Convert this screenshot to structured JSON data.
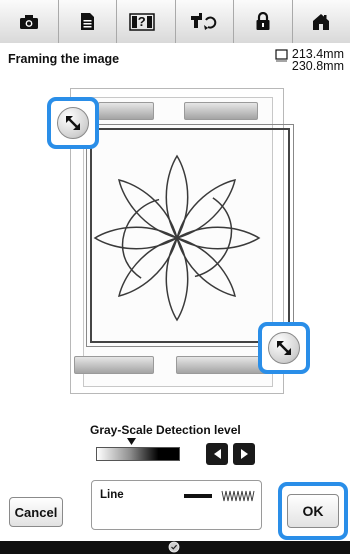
{
  "toolbar": {
    "items": [
      {
        "icon": "camera-icon"
      },
      {
        "icon": "document-icon"
      },
      {
        "icon": "help-icon",
        "label": "?"
      },
      {
        "icon": "machine-thread-icon"
      },
      {
        "icon": "lock-icon"
      },
      {
        "icon": "home-icon"
      }
    ]
  },
  "header": {
    "title": "Framing the image",
    "size_width": "213.4mm",
    "size_height": "230.8mm"
  },
  "grayscale": {
    "label": "Gray-Scale Detection level",
    "level": 0.42
  },
  "line_setting": {
    "label": "Line"
  },
  "buttons": {
    "cancel": "Cancel",
    "ok": "OK"
  },
  "colors": {
    "highlight": "#2a8ee8",
    "toolbar_bg": "#e6e6e6",
    "status_bar": "#101010"
  }
}
